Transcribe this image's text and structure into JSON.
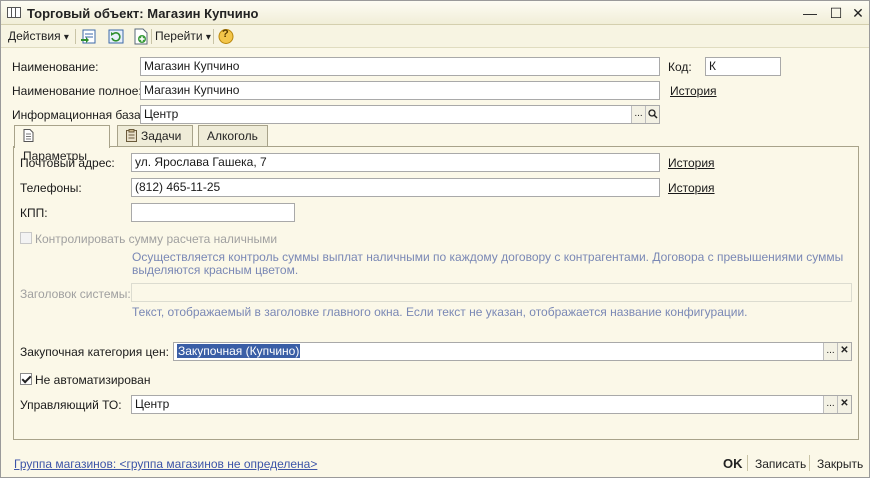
{
  "window": {
    "title": "Торговый объект: Магазин Купчино",
    "controls": [
      "—",
      "☐",
      "✕"
    ]
  },
  "toolbar": {
    "actions_label": "Действия",
    "goto_label": "Перейти",
    "help_glyph": "?"
  },
  "form": {
    "name_label": "Наименование:",
    "name_value": "Магазин Купчино",
    "code_label": "Код:",
    "code_value": "К",
    "full_name_label": "Наименование полное:",
    "full_name_value": "Магазин Купчино",
    "history_link": "История",
    "infobase_label": "Информационная база:",
    "infobase_value": "Центр"
  },
  "tabs": [
    {
      "label": "Параметры",
      "active": true
    },
    {
      "label": "Задачи",
      "active": false
    },
    {
      "label": "Алкоголь",
      "active": false
    }
  ],
  "params": {
    "address_label": "Почтовый адрес:",
    "address_value": "ул. Ярослава Гашека, 7",
    "phones_label": "Телефоны:",
    "phones_value": "(812) 465-11-25",
    "history_link": "История",
    "kpp_label": "КПП:",
    "kpp_value": "",
    "cash_control_label": "Контролировать сумму расчета наличными",
    "cash_control_hint_line1": "Осуществляется контроль суммы выплат наличными по каждому договору с контрагентами. Договора с превышениями суммы",
    "cash_control_hint_line2": "выделяются красным цветом.",
    "system_title_label": "Заголовок системы:",
    "system_title_value": "",
    "system_title_hint": "Текст, отображаемый в заголовке главного окна. Если текст не указан, отображается название конфигурации.",
    "price_category_label": "Закупочная категория цен:",
    "price_category_value": "Закупочная (Купчино)",
    "not_automated_label": "Не автоматизирован",
    "not_automated_checked": true,
    "managing_label": "Управляющий ТО:",
    "managing_value": "Центр"
  },
  "footer": {
    "group_link": "Группа магазинов: <группа магазинов не определена>",
    "ok_label": "OK",
    "save_label": "Записать",
    "close_label": "Закрыть"
  },
  "glyphs": {
    "ellipsis": "...",
    "clear": "✕",
    "dropdown": "▾"
  }
}
